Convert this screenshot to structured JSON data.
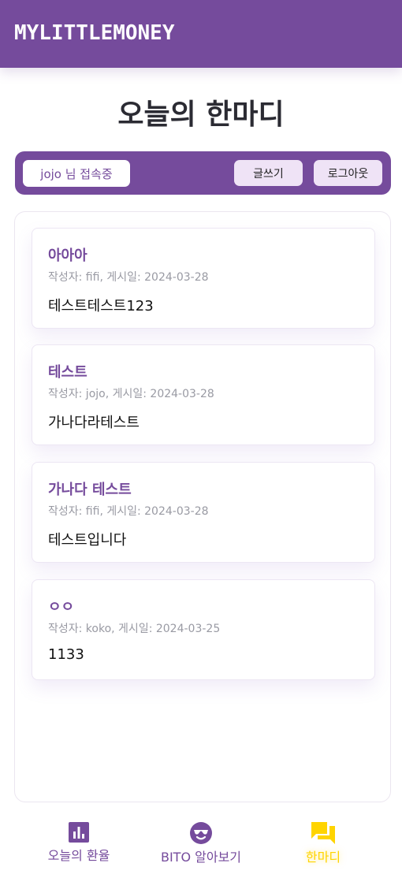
{
  "app": {
    "brand": "MYLITTLEMONEY"
  },
  "page": {
    "title": "오늘의 한마디"
  },
  "user_bar": {
    "user_status": "jojo 님 접속중",
    "write_label": "글쓰기",
    "logout_label": "로그아웃"
  },
  "posts": [
    {
      "title": "아아아",
      "meta": "작성자: fifi, 게시일: 2024-03-28",
      "body": "테스트테스트123"
    },
    {
      "title": "테스트",
      "meta": "작성자: jojo, 게시일: 2024-03-28",
      "body": "가나다라테스트"
    },
    {
      "title": "가나다 테스트",
      "meta": "작성자: fifi, 게시일: 2024-03-28",
      "body": "테스트입니다"
    },
    {
      "title": "ㅇㅇ",
      "meta": "작성자: koko, 게시일: 2024-03-25",
      "body": "1133"
    }
  ],
  "nav": {
    "items": [
      {
        "label": "오늘의 환율",
        "icon": "chart-icon"
      },
      {
        "label": "BITO 알아보기",
        "icon": "sunglasses-face-icon"
      },
      {
        "label": "한마디",
        "icon": "chat-icon",
        "active": true
      }
    ]
  },
  "colors": {
    "accent": "#754b9c",
    "button_bg": "#efe3f6",
    "active_nav": "#ffd400"
  }
}
